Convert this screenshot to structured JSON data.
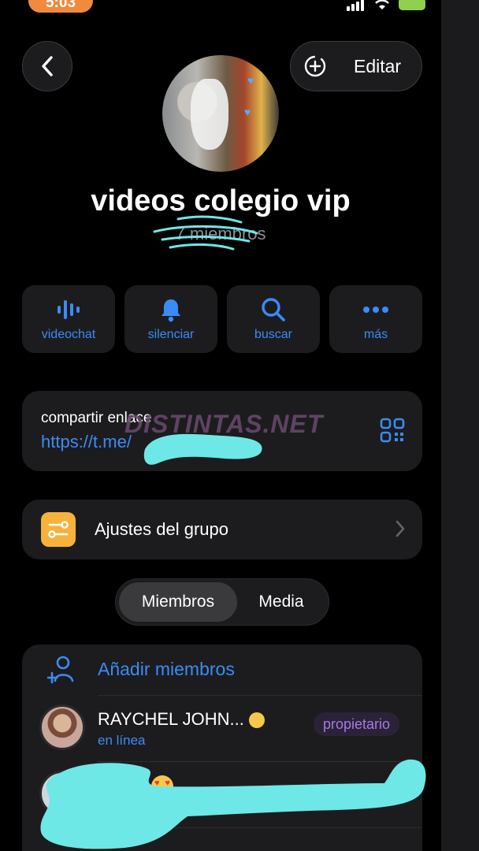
{
  "status_bar": {
    "time": "5:03"
  },
  "header": {
    "edit_label": "Editar"
  },
  "group": {
    "name": "videos colegio vip",
    "member_count": "7 miembros"
  },
  "actions": [
    {
      "label": "videochat",
      "icon": "voice-chat-icon"
    },
    {
      "label": "silenciar",
      "icon": "bell-icon"
    },
    {
      "label": "buscar",
      "icon": "search-icon"
    },
    {
      "label": "más",
      "icon": "more-icon"
    }
  ],
  "share_link": {
    "title": "compartir enlace",
    "url": "https://t.me/"
  },
  "watermark": "DISTINTAS.NET",
  "settings": {
    "label": "Ajustes del grupo"
  },
  "tabs": {
    "members": "Miembros",
    "media": "Media"
  },
  "members": {
    "add_label": "Añadir miembros",
    "list": [
      {
        "name": "RAYCHEL JOHN...",
        "status": "en línea",
        "badge": "propietario"
      }
    ]
  },
  "colors": {
    "accent": "#3b8bf7",
    "settings_icon": "#f7b23b",
    "badge_text": "#a877e6",
    "redaction": "#6ee7e7"
  }
}
